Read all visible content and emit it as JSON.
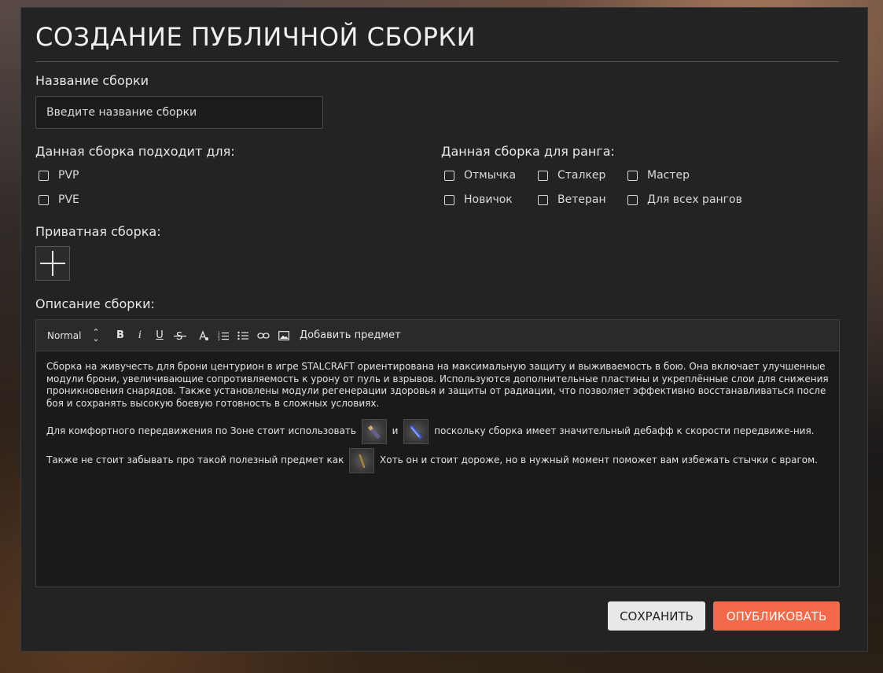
{
  "form": {
    "title": "СОЗДАНИЕ ПУБЛИЧНОЙ СБОРКИ",
    "name_label": "Название сборки",
    "name_placeholder": "Введите название сборки",
    "suitable_label": "Данная сборка подходит для:",
    "suitable_options": [
      "PVP",
      "PVE"
    ],
    "rank_label": "Данная сборка для ранга:",
    "rank_options": [
      "Отмычка",
      "Сталкер",
      "Мастер",
      "Новичок",
      "Ветеран",
      "Для всех рангов"
    ],
    "private_label": "Приватная сборка:",
    "description_label": "Описание сборки:"
  },
  "editor": {
    "format_select": "Normal",
    "toolbar_icons": [
      "bold-icon",
      "italic-icon",
      "underline-icon",
      "strikethrough-icon",
      "text-color-icon",
      "ordered-list-icon",
      "bullet-list-icon",
      "link-icon",
      "image-icon"
    ],
    "add_item_label": "Добавить предмет",
    "paragraph1": "Сборка на живучесть для брони центурион в игре STALCRAFT ориентирована на максимальную защиту и выживаемость в бою. Она включает улучшенные модули брони, увеличивающие сопротивляемость к урону от пуль и взрывов. Используются дополнительные пластины и укреплённые слои для снижения проникновения снарядов. Также установлены модули регенерации здоровья и защиты от радиации, что позволяет эффективно восстанавливаться после боя и сохранять высокую боевую готовность в сложных условиях.",
    "p2_part1": "Для комфортного передвижения по Зоне стоит использовать",
    "p2_and": "и",
    "p2_part2": "поскольку сборка имеет значительный дебафф к скорости передвиже-ния. Также не стоит забывать про такой полезный предмет как",
    "p2_part3": "Хоть он и стоит дороже, но в нужный момент поможет вам избежать стычки с врагом."
  },
  "actions": {
    "save_label": "СОХРАНИТЬ",
    "publish_label": "ОПУБЛИКОВАТЬ"
  },
  "colors": {
    "panel_bg": "#232323",
    "accent": "#f36a4a",
    "save_bg": "#e8e8e8"
  }
}
